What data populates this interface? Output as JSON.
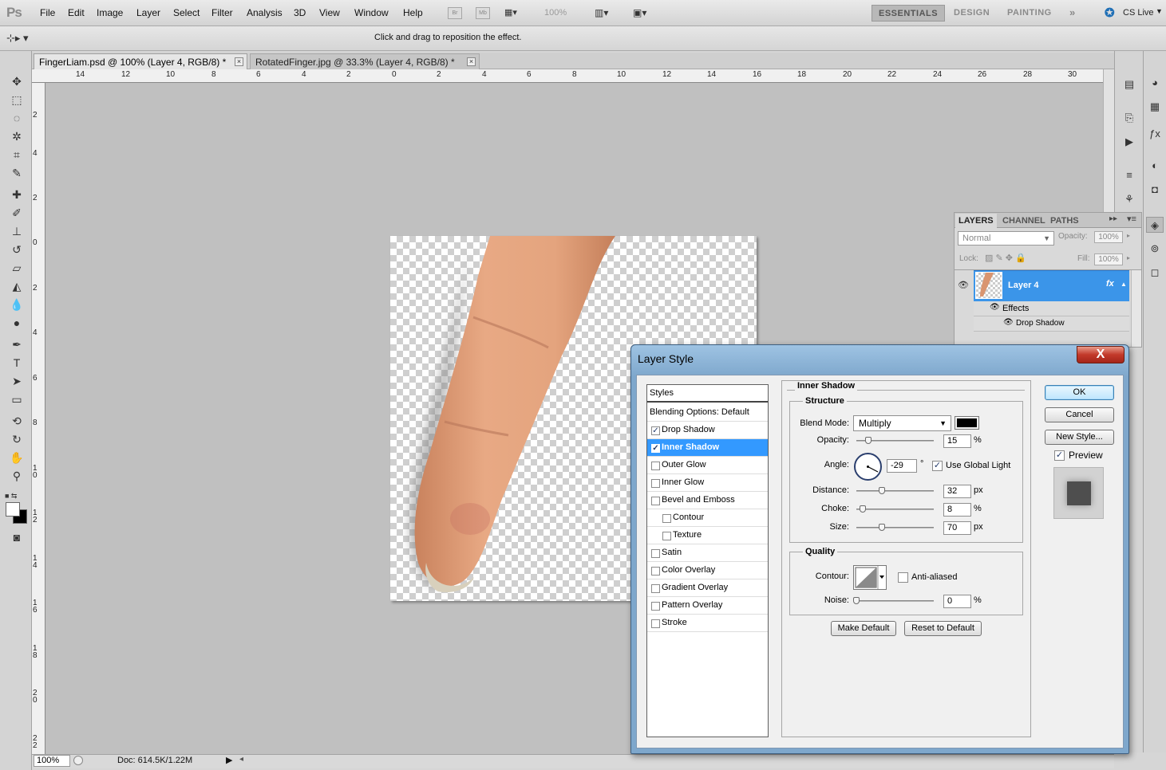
{
  "menu": {
    "logo": "Ps",
    "items": [
      "File",
      "Edit",
      "Image",
      "Layer",
      "Select",
      "Filter",
      "Analysis",
      "3D",
      "View",
      "Window",
      "Help"
    ],
    "zoom": "100%",
    "workspaces": [
      "ESSENTIALS",
      "DESIGN",
      "PAINTING"
    ],
    "cs_live": "CS Live"
  },
  "options": {
    "hint": "Click and drag to reposition the effect."
  },
  "tabs": [
    {
      "label": "FingerLiam.psd @ 100% (Layer 4, RGB/8) *"
    },
    {
      "label": "RotatedFinger.jpg @ 33.3% (Layer 4, RGB/8) *"
    }
  ],
  "ruler": {
    "top_labels": [
      "14",
      "12",
      "10",
      "8",
      "6",
      "4",
      "2",
      "0",
      "2",
      "4",
      "6",
      "8",
      "10",
      "12",
      "14",
      "16",
      "18",
      "20",
      "22",
      "24",
      "26",
      "28",
      "30"
    ],
    "left_labels": [
      "2",
      "4",
      "2",
      "0",
      "2",
      "4",
      "6",
      "8",
      "1 0",
      "1 2",
      "1 4",
      "1 6",
      "1 8",
      "2 0",
      "2 2"
    ]
  },
  "status": {
    "zoom": "100%",
    "doc": "Doc: 614.5K/1.22M"
  },
  "layers_panel": {
    "tabs": [
      "LAYERS",
      "CHANNEL",
      "PATHS"
    ],
    "blend_mode": "Normal",
    "opacity_label": "Opacity:",
    "opacity": "100%",
    "lock_label": "Lock:",
    "fill_label": "Fill:",
    "fill": "100%",
    "layer_name": "Layer 4",
    "fx": "fx",
    "effects_label": "Effects",
    "effect_item": "Drop Shadow"
  },
  "dialog": {
    "title": "Layer Style",
    "close": "X",
    "styles_header": "Styles",
    "styles": [
      {
        "label": "Blending Options: Default",
        "checkbox": false,
        "checked": false,
        "selected": false,
        "sub": false
      },
      {
        "label": "Drop Shadow",
        "checkbox": true,
        "checked": true,
        "selected": false,
        "sub": false
      },
      {
        "label": "Inner Shadow",
        "checkbox": true,
        "checked": true,
        "selected": true,
        "sub": false
      },
      {
        "label": "Outer Glow",
        "checkbox": true,
        "checked": false,
        "selected": false,
        "sub": false
      },
      {
        "label": "Inner Glow",
        "checkbox": true,
        "checked": false,
        "selected": false,
        "sub": false
      },
      {
        "label": "Bevel and Emboss",
        "checkbox": true,
        "checked": false,
        "selected": false,
        "sub": false
      },
      {
        "label": "Contour",
        "checkbox": true,
        "checked": false,
        "selected": false,
        "sub": true
      },
      {
        "label": "Texture",
        "checkbox": true,
        "checked": false,
        "selected": false,
        "sub": true
      },
      {
        "label": "Satin",
        "checkbox": true,
        "checked": false,
        "selected": false,
        "sub": false
      },
      {
        "label": "Color Overlay",
        "checkbox": true,
        "checked": false,
        "selected": false,
        "sub": false
      },
      {
        "label": "Gradient Overlay",
        "checkbox": true,
        "checked": false,
        "selected": false,
        "sub": false
      },
      {
        "label": "Pattern Overlay",
        "checkbox": true,
        "checked": false,
        "selected": false,
        "sub": false
      },
      {
        "label": "Stroke",
        "checkbox": true,
        "checked": false,
        "selected": false,
        "sub": false
      }
    ],
    "section_title": "Inner Shadow",
    "structure": {
      "title": "Structure",
      "blend_mode_label": "Blend Mode:",
      "blend_mode": "Multiply",
      "shadow_color": "#000000",
      "opacity_label": "Opacity:",
      "opacity": "15",
      "opacity_unit": "%",
      "opacity_slider_fraction": 0.15,
      "angle_label": "Angle:",
      "angle": "-29",
      "angle_unit": "°",
      "use_global_light_label": "Use Global Light",
      "use_global_light": true,
      "distance_label": "Distance:",
      "distance": "32",
      "distance_unit": "px",
      "distance_slider_fraction": 0.32,
      "choke_label": "Choke:",
      "choke": "8",
      "choke_unit": "%",
      "choke_slider_fraction": 0.08,
      "size_label": "Size:",
      "size": "70",
      "size_unit": "px",
      "size_slider_fraction": 0.28
    },
    "quality": {
      "title": "Quality",
      "contour_label": "Contour:",
      "anti_aliased_label": "Anti-aliased",
      "anti_aliased": false,
      "noise_label": "Noise:",
      "noise": "0",
      "noise_unit": "%",
      "noise_slider_fraction": 0
    },
    "make_default": "Make Default",
    "reset_default": "Reset to Default",
    "ok": "OK",
    "cancel": "Cancel",
    "new_style": "New Style...",
    "preview_label": "Preview",
    "preview": true
  }
}
